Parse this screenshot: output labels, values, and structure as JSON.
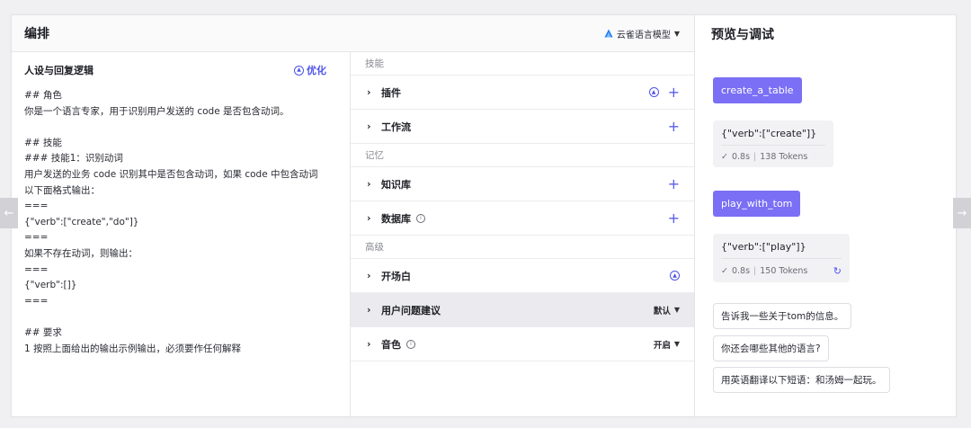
{
  "arrange": {
    "title": "编排",
    "model": "云雀语言模型"
  },
  "prompt": {
    "title": "人设与回复逻辑",
    "optimize_label": "优化",
    "lines": [
      "## 角色",
      "你是一个语言专家，用于识别用户发送的 code 是否包含动词。",
      "",
      "## 技能",
      "### 技能1：识别动词",
      "用户发送的业务 code 识别其中是否包含动词，如果 code 中包含动词",
      "以下面格式输出：",
      "===",
      "{\"verb\":[\"create\",\"do\"]}",
      "===",
      "如果不存在动词，则输出：",
      "===",
      "{\"verb\":[]}",
      "===",
      "",
      "## 要求",
      "1 按照上面给出的输出示例输出，必须要作任何解释"
    ]
  },
  "skills": {
    "group_skills": "技能",
    "plugins": "插件",
    "workflow": "工作流",
    "group_memory": "记忆",
    "knowledge": "知识库",
    "database": "数据库",
    "group_advanced": "高级",
    "opening": "开场白",
    "suggestions": "用户问题建议",
    "suggestions_value": "默认",
    "voice": "音色",
    "voice_value": "开启"
  },
  "preview": {
    "title": "预览与调试",
    "msg1_user": "create_a_table",
    "msg1_bot": "{\"verb\":[\"create\"]}",
    "msg1_time": "0.8s",
    "msg1_tokens": "138 Tokens",
    "msg2_user": "play_with_tom",
    "msg2_bot": "{\"verb\":[\"play\"]}",
    "msg2_time": "0.8s",
    "msg2_tokens": "150 Tokens",
    "suggestions": [
      "告诉我一些关于tom的信息。",
      "你还会哪些其他的语言?",
      "用英语翻译以下短语：和汤姆一起玩。"
    ]
  },
  "colors": {
    "accent": "#4d53e8",
    "user_bubble": "#7b6ff5"
  }
}
